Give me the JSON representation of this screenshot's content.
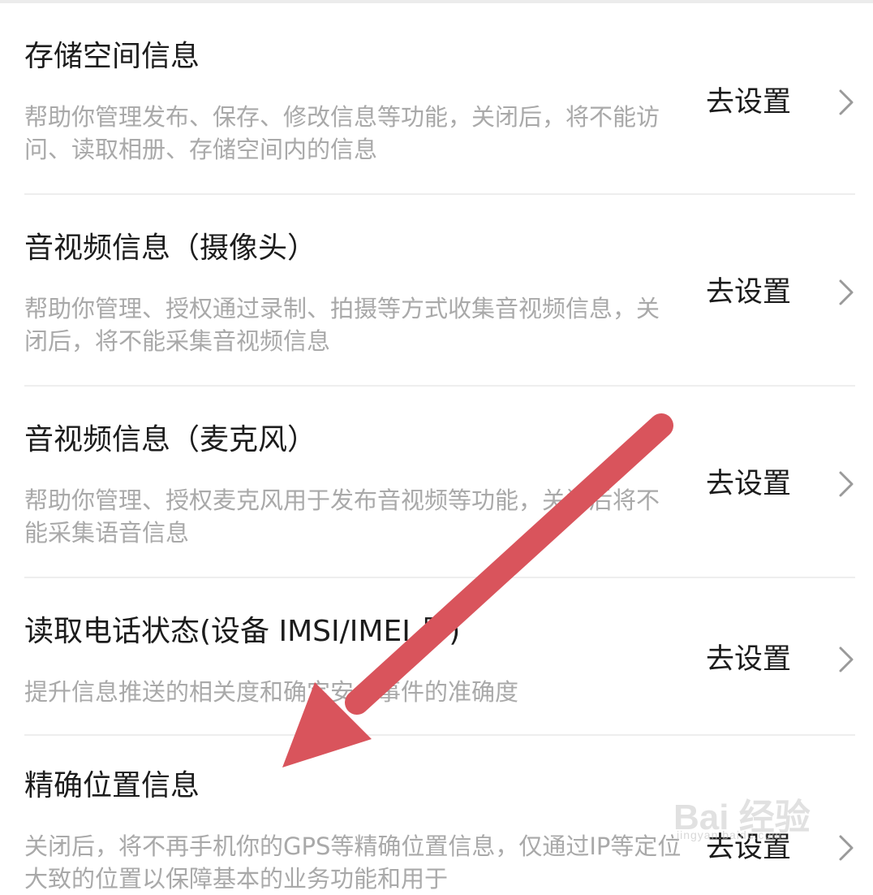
{
  "settings": {
    "items": [
      {
        "title": "存储空间信息",
        "desc": "帮助你管理发布、保存、修改信息等功能，关闭后，将不能访问、读取相册、存储空间内的信息",
        "action": "去设置"
      },
      {
        "title": "音视频信息（摄像头）",
        "desc": "帮助你管理、授权通过录制、拍摄等方式收集音视频信息，关闭后，将不能采集音视频信息",
        "action": "去设置"
      },
      {
        "title": "音视频信息（麦克风）",
        "desc": "帮助你管理、授权麦克风用于发布音视频等功能，关闭后将不能采集语音信息",
        "action": "去设置"
      },
      {
        "title": "读取电话状态(设备 IMSI/IMEI 号)",
        "desc": "提升信息推送的相关度和确定安全事件的准确度",
        "action": "去设置"
      },
      {
        "title": "精确位置信息",
        "desc": "关闭后，将不再手机你的GPS等精确位置信息，仅通过IP等定位大致的位置以保障基本的业务功能和用于",
        "action": "去设置"
      }
    ]
  },
  "annotation": {
    "arrow_color": "#d9545c"
  },
  "watermark": {
    "text": "Bai 经验",
    "sub": "jingyan.baidu.com"
  },
  "icons": {
    "chevron": "chevron-right-icon",
    "arrow": "arrow-annotation-icon",
    "watermark": "paw-logo-icon"
  }
}
